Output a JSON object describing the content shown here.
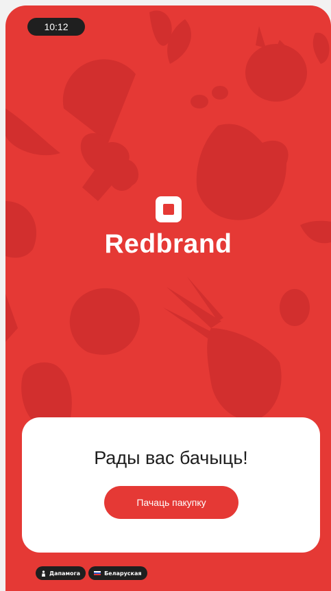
{
  "status_bar": {
    "time": "10:12"
  },
  "brand": {
    "name": "Redbrand"
  },
  "welcome_card": {
    "greeting": "Рады вас бачыць!",
    "start_button_label": "Пачаць пакупку"
  },
  "footer": {
    "help_label": "Дапамога",
    "language_label": "Беларуская",
    "help_icon": "person-icon",
    "language_icon": "flag-icon"
  },
  "colors": {
    "brand_red": "#e53935",
    "shape_red": "#d32f2f",
    "chip_dark": "#1f1f1f",
    "card_white": "#ffffff"
  }
}
